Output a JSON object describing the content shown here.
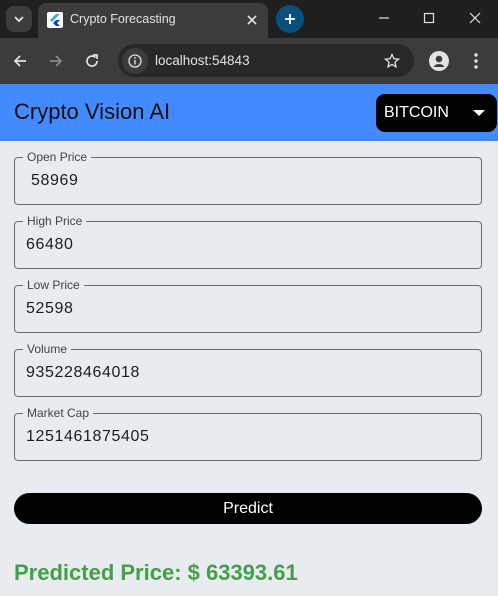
{
  "browser": {
    "tab_title": "Crypto Forecasting",
    "url": "localhost:54843"
  },
  "app": {
    "title": "Crypto Vision AI",
    "coin_selected": "BITCOIN"
  },
  "fields": [
    {
      "label": "Open Price",
      "value": "58969"
    },
    {
      "label": "High Price",
      "value": "66480"
    },
    {
      "label": "Low Price",
      "value": "52598"
    },
    {
      "label": "Volume",
      "value": "935228464018"
    },
    {
      "label": "Market Cap",
      "value": "1251461875405"
    }
  ],
  "predict_label": "Predict",
  "result_text": "Predicted Price: $ 63393.61",
  "colors": {
    "appbar": "#448aff",
    "result": "#43a047",
    "button": "#000000"
  }
}
